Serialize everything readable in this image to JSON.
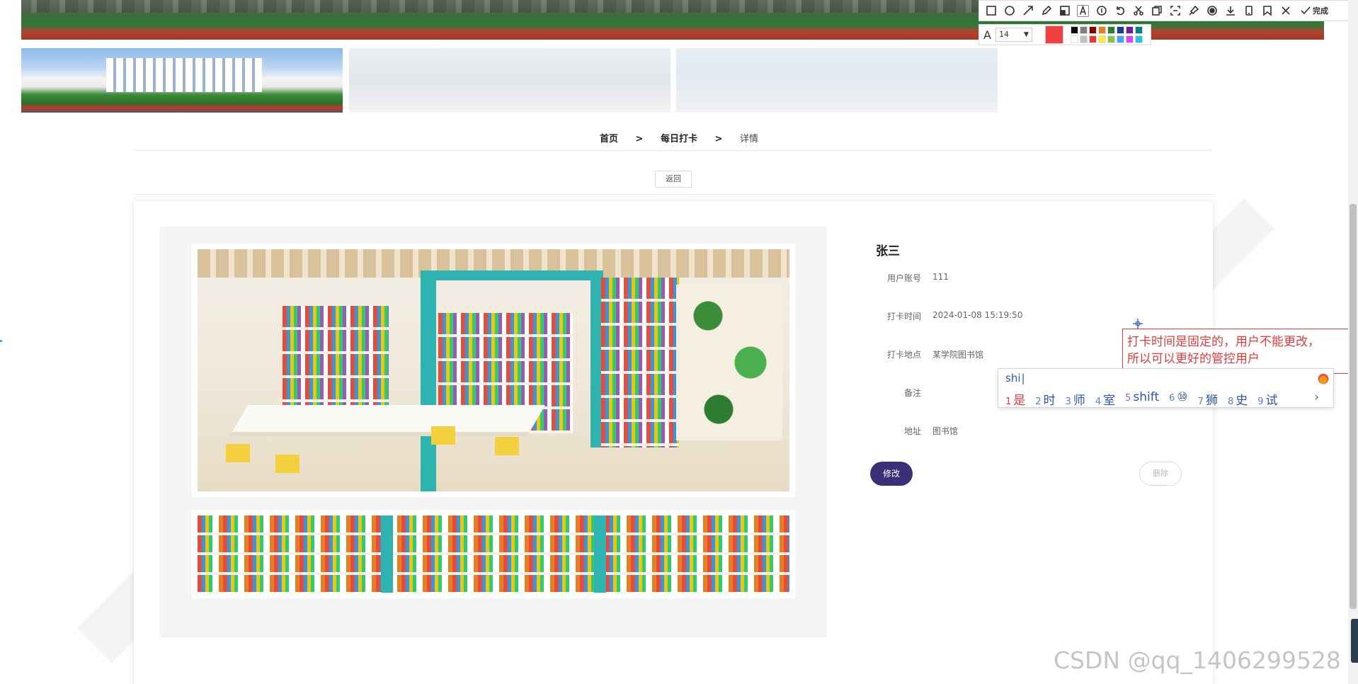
{
  "breadcrumb": {
    "home": "首页",
    "sep1": ">",
    "checkin": "每日打卡",
    "sep2": ">",
    "detail": "详情"
  },
  "back_button": "返回",
  "detail": {
    "name": "张三",
    "fields": [
      {
        "label": "用户账号",
        "value": "111"
      },
      {
        "label": "打卡时间",
        "value": "2024-01-08 15:19:50"
      },
      {
        "label": "打卡地点",
        "value": "某学院图书馆"
      },
      {
        "label": "备注",
        "value": ""
      },
      {
        "label": "地址",
        "value": "图书馆"
      }
    ],
    "edit_button": "修改",
    "delete_button": "删除"
  },
  "annotation_toolbar": {
    "tools": [
      "rectangle-icon",
      "ellipse-icon",
      "arrow-icon",
      "pencil-icon",
      "mosaic-icon",
      "text-icon",
      "number-icon",
      "undo-icon",
      "scissors-icon",
      "copy-icon",
      "ocr-icon",
      "pin-icon",
      "record-icon",
      "download-icon",
      "phone-icon",
      "bookmark-icon",
      "close-icon",
      "check-icon"
    ],
    "done_label": "完成",
    "font_glyph": "A",
    "font_size": "14",
    "current_color": "#f04040",
    "palette": [
      "#000000",
      "#808080",
      "#800000",
      "#e67e22",
      "#2e7d32",
      "#1e3a8a",
      "#6a1b9a",
      "#008080",
      "#ffffff",
      "#c0c0c0",
      "#e53935",
      "#ffeb3b",
      "#8bc34a",
      "#42a5f5",
      "#e040fb",
      "#26c6da"
    ]
  },
  "annotation_text": {
    "line1": "打卡时间是固定的，用户不能更改，",
    "line2": "所以可以更好的管控用户"
  },
  "ime": {
    "pinyin": "shi",
    "candidates": [
      {
        "num": "1",
        "text": "是"
      },
      {
        "num": "2",
        "text": "时"
      },
      {
        "num": "3",
        "text": "师"
      },
      {
        "num": "4",
        "text": "室"
      },
      {
        "num": "5",
        "text": "shift"
      },
      {
        "num": "6",
        "text": "⑩"
      },
      {
        "num": "7",
        "text": "狮"
      },
      {
        "num": "8",
        "text": "史"
      },
      {
        "num": "9",
        "text": "试"
      }
    ],
    "more": "›"
  },
  "watermark": "CSDN @qq_1406299528"
}
